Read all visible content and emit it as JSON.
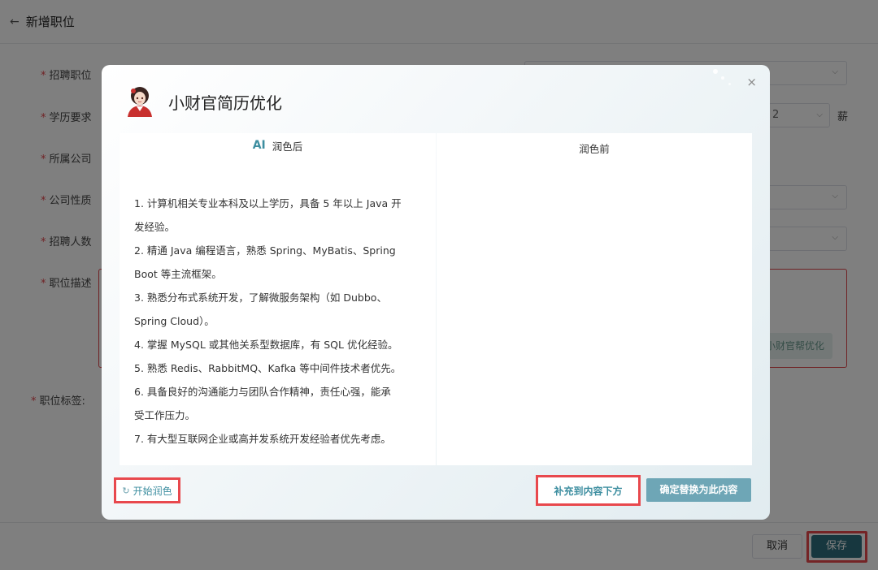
{
  "page": {
    "back_arrow": "←",
    "title": "新增职位"
  },
  "form": {
    "labels": {
      "position": "招聘职位",
      "education": "学历要求",
      "company": "所属公司",
      "company_type": "公司性质",
      "headcount": "招聘人数",
      "description": "职位描述",
      "tags": "职位标签:"
    },
    "required_mark": "*",
    "year_value": "2",
    "salary_label": "薪",
    "ai_button": "小财官帮优化"
  },
  "footer": {
    "cancel": "取消",
    "save": "保存"
  },
  "modal": {
    "title": "小财官简历优化",
    "close_icon": "×",
    "left_panel": {
      "ai_mark": "AI",
      "title": "润色后",
      "lines": [
        "1. 计算机相关专业本科及以上学历，具备 5 年以上 Java 开",
        "发经验。",
        "2. 精通 Java 编程语言，熟悉 Spring、MyBatis、Spring",
        "Boot 等主流框架。",
        "3. 熟悉分布式系统开发，了解微服务架构（如 Dubbo、",
        "Spring Cloud）。",
        "4. 掌握 MySQL 或其他关系型数据库，有 SQL 优化经验。",
        "5. 熟悉 Redis、RabbitMQ、Kafka 等中间件技术者优先。",
        "6. 具备良好的沟通能力与团队合作精神，责任心强，能承",
        "受工作压力。",
        "7. 有大型互联网企业或高并发系统开发经验者优先考虑。"
      ]
    },
    "right_panel": {
      "title": "润色前"
    },
    "restart_icon": "↻",
    "restart_label": "开始润色",
    "append_label": "补充到内容下方",
    "replace_label": "确定替换为此内容"
  },
  "colors": {
    "accent": "#3d8ea0",
    "highlight_outline": "#e8484d",
    "save_bg": "#2f6f7e"
  }
}
